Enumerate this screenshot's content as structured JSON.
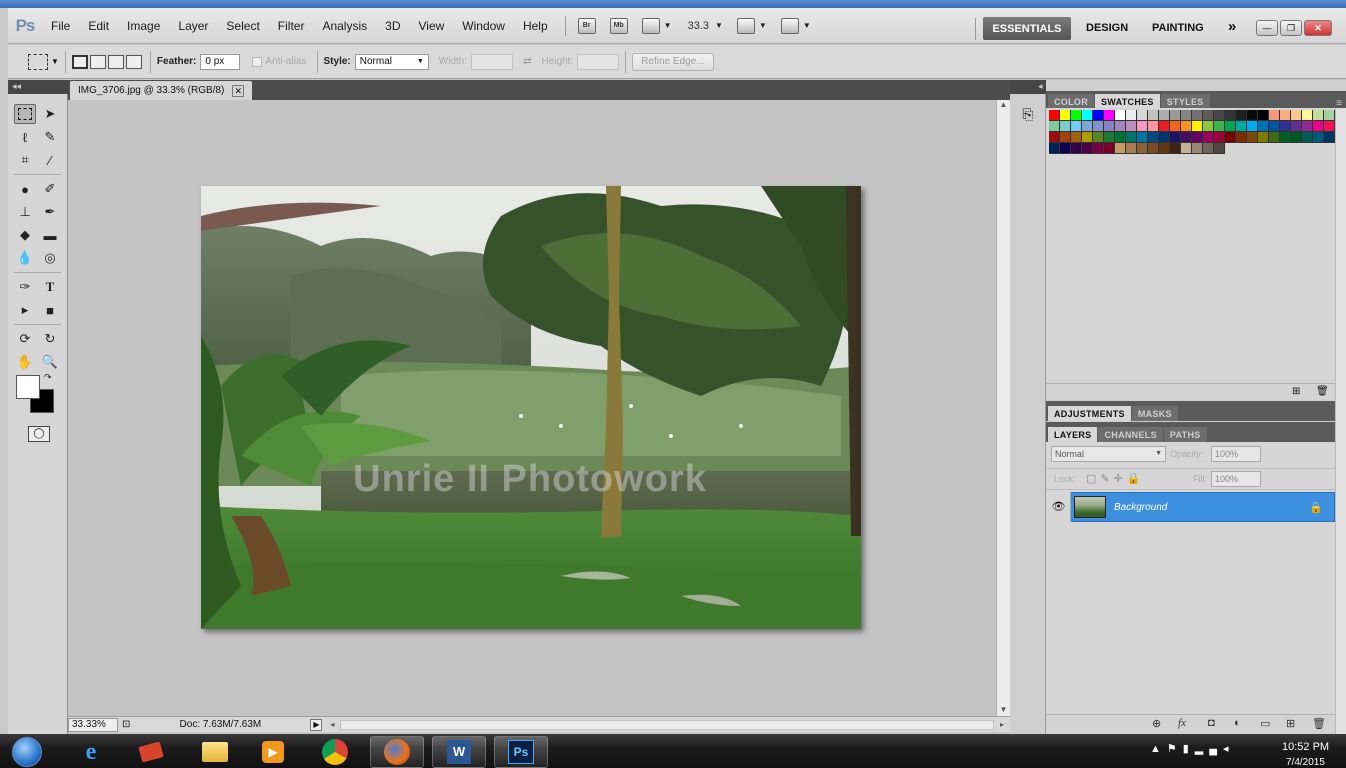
{
  "app": {
    "logo": "Ps",
    "menu": [
      "File",
      "Edit",
      "Image",
      "Layer",
      "Select",
      "Filter",
      "Analysis",
      "3D",
      "View",
      "Window",
      "Help"
    ],
    "bridge_icon": "Br",
    "minibridge_icon": "Mb",
    "zoom_level": "33.3",
    "workspaces": {
      "essentials": "ESSENTIALS",
      "design": "DESIGN",
      "painting": "PAINTING",
      "more": "»"
    }
  },
  "options": {
    "feather_label": "Feather:",
    "feather_value": "0 px",
    "antialias_label": "Anti-alias",
    "style_label": "Style:",
    "style_value": "Normal",
    "width_label": "Width:",
    "height_label": "Height:",
    "refine_edge": "Refine Edge..."
  },
  "document": {
    "tab_title": "IMG_3706.jpg @ 33.3% (RGB/8)",
    "watermark": "Unrie II Photowork",
    "status_zoom": "33.33%",
    "status_doc": "Doc: 7.63M/7.63M"
  },
  "panels": {
    "swatch_tabs": [
      "COLOR",
      "SWATCHES",
      "STYLES"
    ],
    "adjust_tabs": [
      "ADJUSTMENTS",
      "MASKS"
    ],
    "layer_tabs": [
      "LAYERS",
      "CHANNELS",
      "PATHS"
    ],
    "blend_mode": "Normal",
    "opacity_label": "Opacity:",
    "opacity_value": "100%",
    "lock_label": "Lock:",
    "fill_label": "Fill:",
    "fill_value": "100%",
    "layer_name": "Background"
  },
  "swatches": [
    "#ff0000",
    "#ffff00",
    "#00ff00",
    "#00ffff",
    "#0000ff",
    "#ff00ff",
    "#ffffff",
    "#ebebeb",
    "#d6d6d6",
    "#c2c2c2",
    "#adadad",
    "#999999",
    "#858585",
    "#707070",
    "#5c5c5c",
    "#474747",
    "#333333",
    "#1f1f1f",
    "#0a0a0a",
    "#000000",
    "#f7977a",
    "#f9ad81",
    "#fdc68a",
    "#fff79a",
    "#c4df9b",
    "#a2d39c",
    "#82ca9d",
    "#7bcdc8",
    "#6ecff6",
    "#7ea7d8",
    "#8493ca",
    "#8882be",
    "#a187be",
    "#bc8dbf",
    "#f49ac2",
    "#f6989d",
    "#ed1c24",
    "#f26522",
    "#f7941d",
    "#fff200",
    "#8dc63f",
    "#39b54a",
    "#00a651",
    "#00a99d",
    "#00aeef",
    "#0072bc",
    "#0054a6",
    "#2e3192",
    "#662d91",
    "#92278f",
    "#ec008c",
    "#ed145b",
    "#9e0b0f",
    "#a0410d",
    "#a36209",
    "#aba000",
    "#598527",
    "#1a7b30",
    "#007236",
    "#00746b",
    "#0076a3",
    "#004b80",
    "#003471",
    "#1b1464",
    "#440e62",
    "#630460",
    "#9e005d",
    "#9e0039",
    "#790000",
    "#7b2e00",
    "#7d4900",
    "#827b00",
    "#406618",
    "#005e20",
    "#005826",
    "#005952",
    "#005b7f",
    "#003663",
    "#002157",
    "#0d004c",
    "#32004b",
    "#4b0049",
    "#7b0046",
    "#7a0026",
    "#c69c6d",
    "#a67c52",
    "#8c6239",
    "#754c24",
    "#603913",
    "#3c2415",
    "#c7b299",
    "#998675",
    "#736357",
    "#534741"
  ],
  "taskbar": {
    "clock_time": "10:52 PM",
    "clock_date": "7/4/2015"
  }
}
